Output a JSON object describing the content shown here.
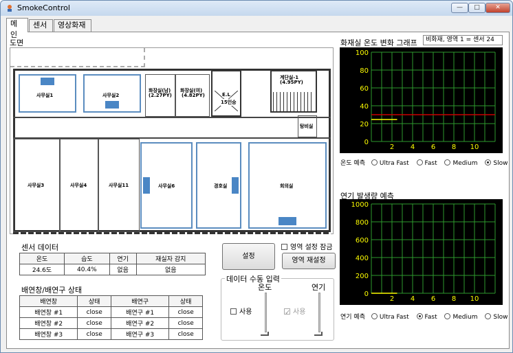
{
  "window": {
    "title": "SmokeControl"
  },
  "tabs": [
    {
      "label": "메인"
    },
    {
      "label": "센서"
    },
    {
      "label": "영상화재"
    }
  ],
  "floorplan": {
    "label": "도면",
    "rooms": {
      "office1": "사무실1",
      "office2": "사무실2",
      "restroom_m": "화장실(남)",
      "restroom_m_area": "(2.27PY)",
      "restroom_f": "화장실(여)",
      "restroom_f_area": "(4.82PY)",
      "elevator": "E.L",
      "elevator_sub": "15인승",
      "stair": "계단실-1",
      "stair_area": "(4.95PY)",
      "stair_small": "탕비실",
      "office3": "사무실3",
      "office4": "사무실4",
      "office11": "사무실11",
      "office6": "사무실6",
      "guard": "경호실",
      "meeting": "회의실"
    }
  },
  "sensor_data": {
    "title": "센서 데이터",
    "headers": [
      "온도",
      "습도",
      "연기",
      "재실자 감지"
    ],
    "values": [
      "24.6도",
      "40.4%",
      "없음",
      "없음"
    ]
  },
  "vents": {
    "title": "배연창/배연구 상태",
    "headers": [
      "배연창",
      "상태",
      "배연구",
      "상태"
    ],
    "rows": [
      [
        "배연창 #1",
        "close",
        "배연구 #1",
        "close"
      ],
      [
        "배연창 #2",
        "close",
        "배연구 #2",
        "close"
      ],
      [
        "배연창 #3",
        "close",
        "배연구 #3",
        "close"
      ]
    ]
  },
  "controls": {
    "settings_button": "설정",
    "area_lock_label": "영역 설정 잠금",
    "area_reset_button": "영역 재설정",
    "manual_group": "데이터 수동 입력",
    "temp_label": "온도",
    "smoke_label": "연기",
    "use_temp": "사용",
    "use_smoke": "사용"
  },
  "temp_chart": {
    "title": "화재실 온도 변화 그래프",
    "selector": "비화재, 영역 1 = 센서 24",
    "predict_label": "온도 예측",
    "options": [
      "Ultra Fast",
      "Fast",
      "Medium",
      "Slow"
    ],
    "selected": "Slow"
  },
  "smoke_chart": {
    "title": "연기 발생량 예측",
    "predict_label": "연기 예측",
    "options": [
      "Ultra Fast",
      "Fast",
      "Medium",
      "Slow"
    ],
    "selected": "Fast"
  },
  "colors": {
    "grid": "#2e9a2e",
    "axis_text": "#ffff00",
    "threshold": "#cc0000",
    "series": "#ffff00"
  },
  "chart_data": [
    {
      "type": "line",
      "title": "화재실 온도 변화 그래프",
      "x_ticks": [
        2,
        4,
        6,
        8,
        10
      ],
      "y_ticks": [
        0,
        20,
        40,
        60,
        80,
        100
      ],
      "xlim": [
        0,
        12
      ],
      "ylim": [
        0,
        100
      ],
      "threshold": 30,
      "series": [
        {
          "x": [
            0,
            2.5
          ],
          "y": [
            24.6,
            24.6
          ]
        }
      ]
    },
    {
      "type": "line",
      "title": "연기 발생량 예측",
      "x_ticks": [
        2,
        4,
        6,
        8,
        10
      ],
      "y_ticks": [
        0,
        200,
        400,
        600,
        800,
        1000
      ],
      "xlim": [
        0,
        12
      ],
      "ylim": [
        0,
        1000
      ],
      "series": [
        {
          "x": [
            0,
            2.5
          ],
          "y": [
            0,
            0
          ]
        }
      ]
    }
  ]
}
